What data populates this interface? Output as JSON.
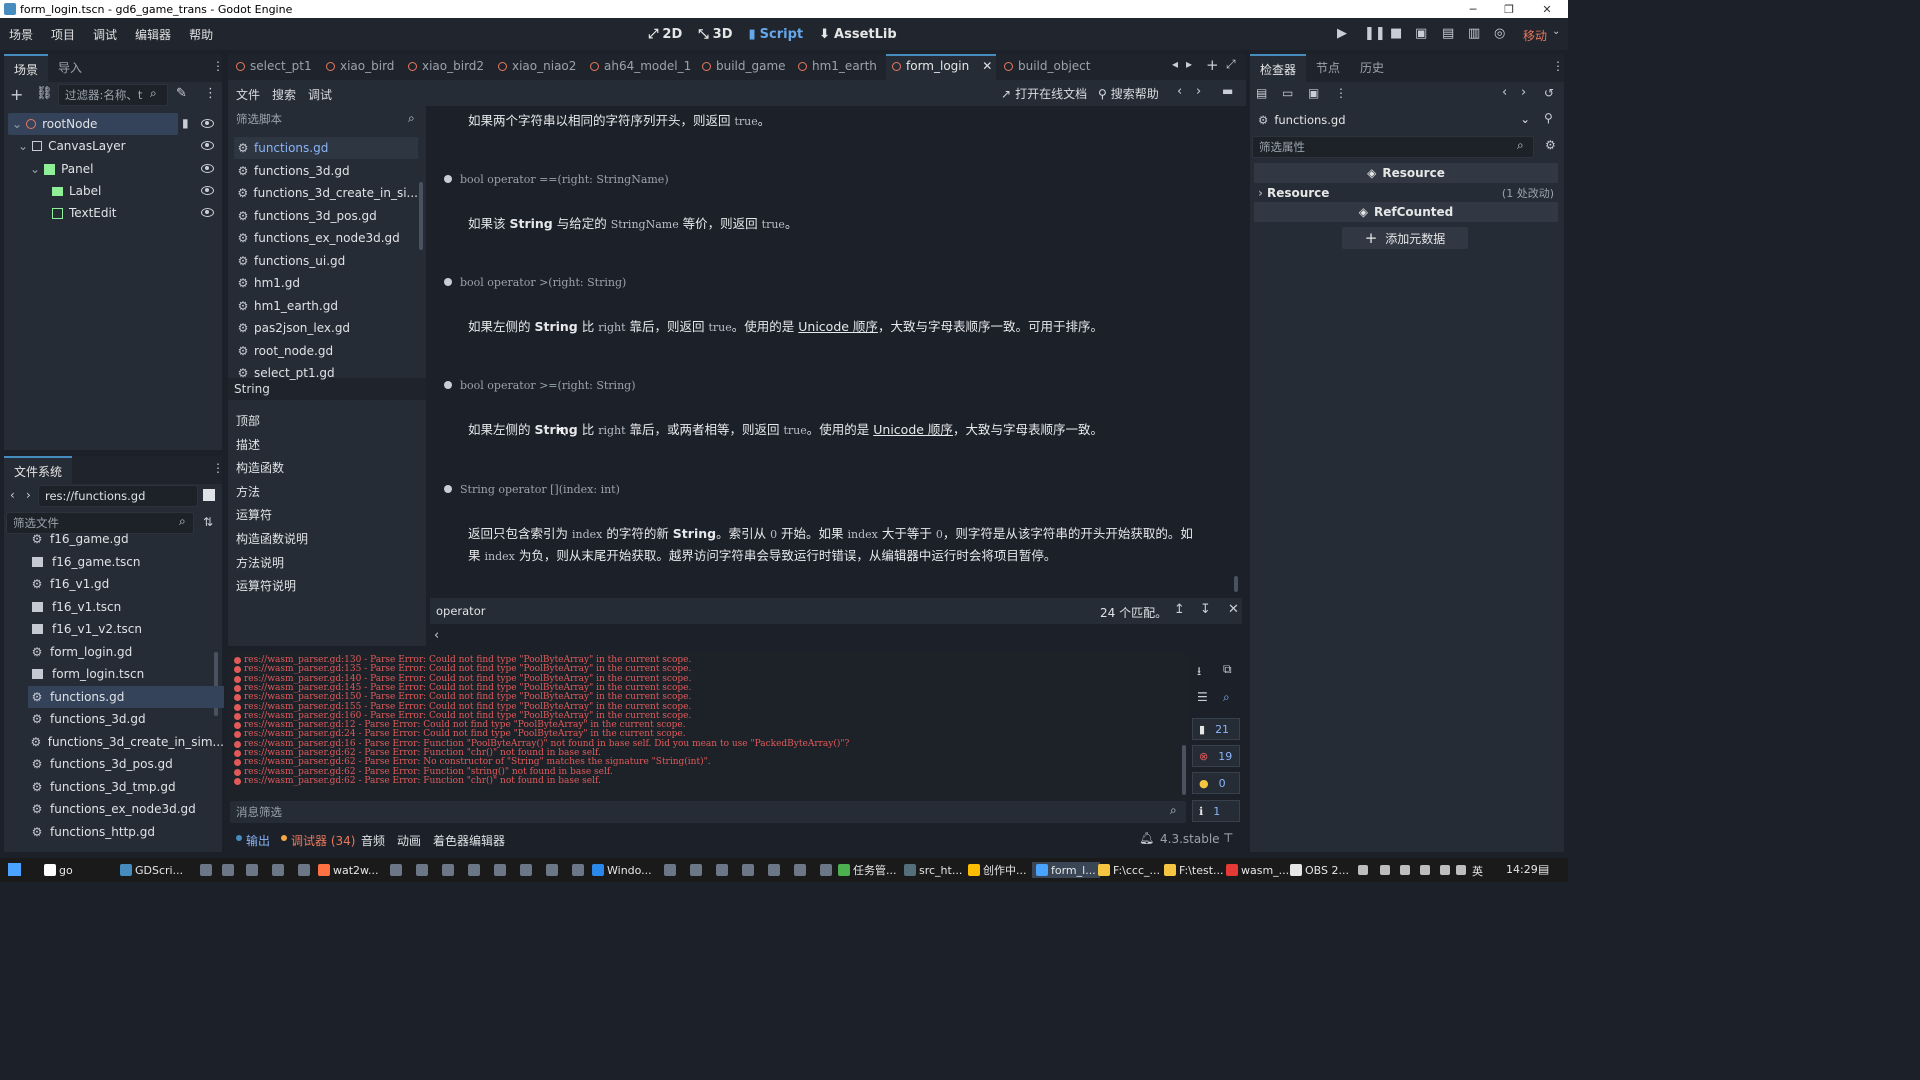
{
  "window": {
    "title": "form_login.tscn - gd6_game_trans - Godot Engine"
  },
  "menu": [
    "场景",
    "项目",
    "调试",
    "编辑器",
    "帮助"
  ],
  "workspaces": [
    {
      "label": "2D",
      "icon": "2d-icon"
    },
    {
      "label": "3D",
      "icon": "3d-icon"
    },
    {
      "label": "Script",
      "icon": "script-icon"
    },
    {
      "label": "AssetLib",
      "icon": "download-icon"
    }
  ],
  "run_controls": {
    "renderer": "移动"
  },
  "scene_dock": {
    "tabs": [
      "场景",
      "导入"
    ],
    "filter_placeholder": "过滤器:名称、t",
    "nodes": [
      {
        "name": "rootNode"
      },
      {
        "name": "CanvasLayer"
      },
      {
        "name": "Panel"
      },
      {
        "name": "Label"
      },
      {
        "name": "TextEdit"
      }
    ]
  },
  "filesystem": {
    "title": "文件系统",
    "path": "res://functions.gd",
    "filter_placeholder": "筛选文件",
    "files": [
      {
        "name": "f16_game.gd",
        "kind": "script"
      },
      {
        "name": "f16_game.tscn",
        "kind": "scene"
      },
      {
        "name": "f16_v1.gd",
        "kind": "script"
      },
      {
        "name": "f16_v1.tscn",
        "kind": "scene"
      },
      {
        "name": "f16_v1_v2.tscn",
        "kind": "scene"
      },
      {
        "name": "form_login.gd",
        "kind": "script"
      },
      {
        "name": "form_login.tscn",
        "kind": "scene"
      },
      {
        "name": "functions.gd",
        "kind": "script",
        "selected": true
      },
      {
        "name": "functions_3d.gd",
        "kind": "script"
      },
      {
        "name": "functions_3d_create_in_sim...",
        "kind": "script"
      },
      {
        "name": "functions_3d_pos.gd",
        "kind": "script"
      },
      {
        "name": "functions_3d_tmp.gd",
        "kind": "script"
      },
      {
        "name": "functions_ex_node3d.gd",
        "kind": "script"
      },
      {
        "name": "functions_http.gd",
        "kind": "script"
      }
    ]
  },
  "editor_tabs": [
    "select_pt1",
    "xiao_bird",
    "xiao_bird2",
    "xiao_niao2",
    "ah64_model_1",
    "build_game",
    "hm1_earth",
    "form_login",
    "build_object"
  ],
  "script_menu": [
    "文件",
    "搜索",
    "调试"
  ],
  "script_toolbar": {
    "online_docs": "打开在线文档",
    "search_help": "搜索帮助"
  },
  "script_list": {
    "filter_placeholder": "筛选脚本",
    "items": [
      "functions.gd",
      "functions_3d.gd",
      "functions_3d_create_in_si...",
      "functions_3d_pos.gd",
      "functions_ex_node3d.gd",
      "functions_ui.gd",
      "hm1.gd",
      "hm1_earth.gd",
      "pas2json_lex.gd",
      "root_node.gd",
      "select_pt1.gd"
    ]
  },
  "outline": {
    "title": "String",
    "items": [
      "顶部",
      "描述",
      "构造函数",
      "方法",
      "运算符",
      "构造函数说明",
      "方法说明",
      "运算符说明"
    ]
  },
  "doc": {
    "line0": {
      "a": "如果两个字符串以相同的字符序列开头，则返回 ",
      "code": "true",
      "b": "。"
    },
    "sig1": "bool operator ==(right: StringName)",
    "desc1": {
      "a": "如果该 ",
      "b": "String",
      "c": " 与给定的 ",
      "code1": "StringName",
      "d": " 等价，则返回 ",
      "code2": "true",
      "e": "。"
    },
    "sig2": "bool operator >(right: String)",
    "desc2": {
      "a": "如果左侧的 ",
      "b": "String",
      "c": " 比 ",
      "code1": "right",
      "d": " 靠后，则返回 ",
      "code2": "true",
      "e": "。使用的是 ",
      "link": "Unicode 顺序",
      "f": "，大致与字母表顺序一致。可用于排序。"
    },
    "sig3": "bool operator >=(right: String)",
    "desc3": {
      "a": "如果左侧的 ",
      "b": "String",
      "c": " 比 ",
      "code1": "right",
      "d": " 靠后，或两者相等，则返回 ",
      "code2": "true",
      "e": "。使用的是 ",
      "link": "Unicode 顺序",
      "f": "，大致与字母表顺序一致。"
    },
    "sig4": "String operator [](index: int)",
    "desc4a": {
      "a": "返回只包含索引为 ",
      "code1": "index",
      "b": " 的字符的新 ",
      "c": "String",
      "d": "。索引从 ",
      "code2": "0",
      "e": " 开始。如果 ",
      "code3": "index",
      "f": " 大于等于 ",
      "code4": "0",
      "g": "，则字符是从该字符串的开头开始获取的。如"
    },
    "desc4b": {
      "a": "果 ",
      "code1": "index",
      "b": " 为负，则从末尾开始获取。越界访问字符串会导致运行时错误，从编辑器中运行时会将项目暂停。"
    }
  },
  "search_bar": {
    "query": "operator",
    "matches": "24 个匹配。"
  },
  "output": {
    "lines": [
      "res://wasm_parser.gd:130 - Parse Error: Could not find type \"PoolByteArray\" in the current scope.",
      "res://wasm_parser.gd:135 - Parse Error: Could not find type \"PoolByteArray\" in the current scope.",
      "res://wasm_parser.gd:140 - Parse Error: Could not find type \"PoolByteArray\" in the current scope.",
      "res://wasm_parser.gd:145 - Parse Error: Could not find type \"PoolByteArray\" in the current scope.",
      "res://wasm_parser.gd:150 - Parse Error: Could not find type \"PoolByteArray\" in the current scope.",
      "res://wasm_parser.gd:155 - Parse Error: Could not find type \"PoolByteArray\" in the current scope.",
      "res://wasm_parser.gd:160 - Parse Error: Could not find type \"PoolByteArray\" in the current scope.",
      "res://wasm_parser.gd:12 - Parse Error: Could not find type \"PoolByteArray\" in the current scope.",
      "res://wasm_parser.gd:24 - Parse Error: Could not find type \"PoolByteArray\" in the current scope.",
      "res://wasm_parser.gd:16 - Parse Error: Function \"PoolByteArray()\" not found in base self. Did you mean to use \"PackedByteArray()\"?",
      "res://wasm_parser.gd:62 - Parse Error: Function \"chr()\" not found in base self.",
      "res://wasm_parser.gd:62 - Parse Error: No constructor of \"String\" matches the signature \"String(int)\".",
      "res://wasm_parser.gd:62 - Parse Error: Function \"string()\" not found in base self.",
      "res://wasm_parser.gd:62 - Parse Error: Function \"chr()\" not found in base self."
    ],
    "filter_placeholder": "消息筛选",
    "counts": {
      "all": "21",
      "errors": "19",
      "warnings": "0",
      "info": "1"
    }
  },
  "bottom_tabs": [
    "输出",
    "调试器 (34)",
    "音频",
    "动画",
    "着色器编辑器"
  ],
  "version": "4.3.stable",
  "inspector": {
    "tabs": [
      "检查器",
      "节点",
      "历史"
    ],
    "object": "functions.gd",
    "filter_placeholder": "筛选属性",
    "section_resource": "Resource",
    "group_resource": "Resource",
    "group_changes": "(1 处改动)",
    "section_refcounted": "RefCounted",
    "add_metadata": "添加元数据"
  },
  "taskbar": {
    "items": [
      "go",
      "GDScri...",
      "wat2w...",
      "Windo...",
      "任务管...",
      "src_ht...",
      "创作中...",
      "form_l...",
      "F:\\ccc_...",
      "F:\\test...",
      "wasm_...",
      "OBS 2..."
    ],
    "ime": "英",
    "time": "14:29"
  },
  "colors": {
    "accent": "#478cbf",
    "error": "#e05a5a",
    "bg": "#1c2028",
    "panel": "#262c35"
  }
}
